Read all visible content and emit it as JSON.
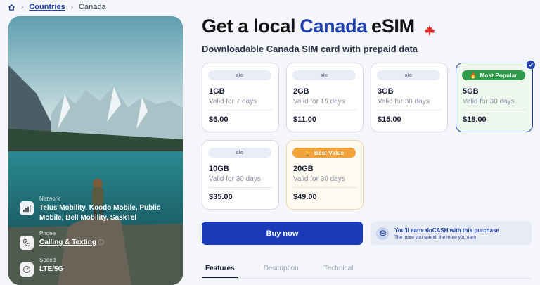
{
  "breadcrumb": {
    "countries": "Countries",
    "current": "Canada"
  },
  "title": {
    "prefix": "Get a local",
    "country": "Canada",
    "suffix": "eSIM"
  },
  "subtitle": "Downloadable Canada SIM card with prepaid data",
  "hero": {
    "network_label": "Network",
    "network_value": "Telus Mobility, Koodo Mobile, Public Mobile, Bell Mobility, SaskTel",
    "phone_label": "Phone",
    "phone_value": "Calling & Texting",
    "speed_label": "Speed",
    "speed_value": "LTE/5G"
  },
  "plans": [
    {
      "badge": "alo",
      "data": "1GB",
      "valid": "Valid for 7 days",
      "price": "$6.00"
    },
    {
      "badge": "alo",
      "data": "2GB",
      "valid": "Valid for 15 days",
      "price": "$11.00"
    },
    {
      "badge": "alo",
      "data": "3GB",
      "valid": "Valid for 30 days",
      "price": "$15.00"
    },
    {
      "badge": "Most Popular",
      "data": "5GB",
      "valid": "Valid for 30 days",
      "price": "$18.00",
      "selected": true
    },
    {
      "badge": "alo",
      "data": "10GB",
      "valid": "Valid for 30 days",
      "price": "$35.00"
    },
    {
      "badge": "Best Value",
      "data": "20GB",
      "valid": "Valid for 30 days",
      "price": "$49.00"
    }
  ],
  "buy_label": "Buy now",
  "earn": {
    "title": "You'll earn aloCASH with this purchase",
    "subtitle": "The more you spend, the more you earn"
  },
  "tabs": [
    "Features",
    "Description",
    "Technical"
  ],
  "colors": {
    "brand_blue": "#1e3fae",
    "popular_green": "#2e9c4a",
    "best_orange": "#f2a23a"
  }
}
